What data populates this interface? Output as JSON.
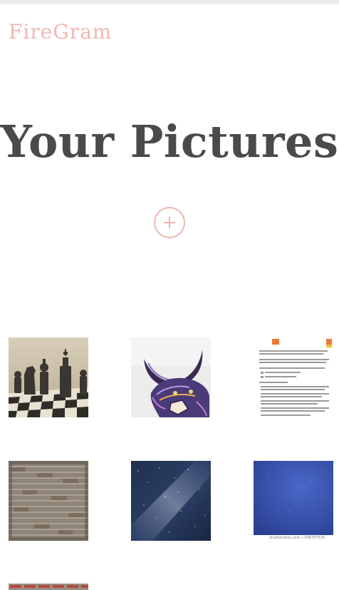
{
  "header": {
    "brand": "FireGram"
  },
  "main": {
    "title": "Your Pictures",
    "add_icon": "plus-circle-icon"
  },
  "colors": {
    "accent": "#efb6b0",
    "title": "#4a4a4a"
  },
  "gallery": {
    "images": [
      {
        "name": "chess pieces photo"
      },
      {
        "name": "purple ornamental animal illustration"
      },
      {
        "name": "document screenshot"
      },
      {
        "name": "brick wall photo"
      },
      {
        "name": "milky way night sky photo"
      },
      {
        "name": "blue sky photo"
      }
    ],
    "caption": "shutterstock.com • 436737535"
  }
}
